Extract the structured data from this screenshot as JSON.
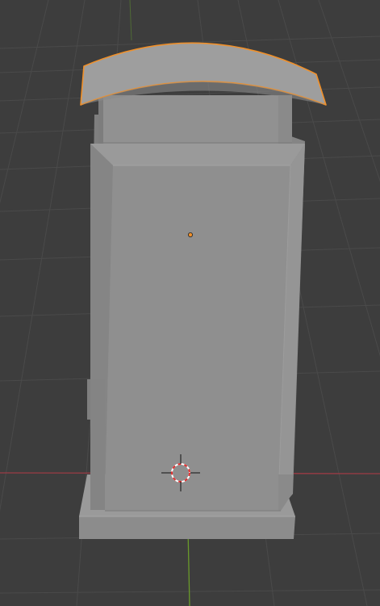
{
  "viewport": {
    "background_color": "#3d3d3d",
    "grid_color": "#4a4a4a",
    "x_axis_color": "#9b3b45",
    "y_axis_color": "#6a9a2a"
  },
  "scene": {
    "object_base_color": "#8f8f8f",
    "object_light_color": "#a9a9a9",
    "object_dark_color": "#7a7a7a",
    "selection_outline_color": "#f0902a",
    "origin_dot_color": "#f0902a",
    "selected_object": "lid"
  },
  "cursor_3d": {
    "icon": "3d-cursor-icon",
    "ring_colors": [
      "#e03030",
      "#ffffff"
    ]
  }
}
